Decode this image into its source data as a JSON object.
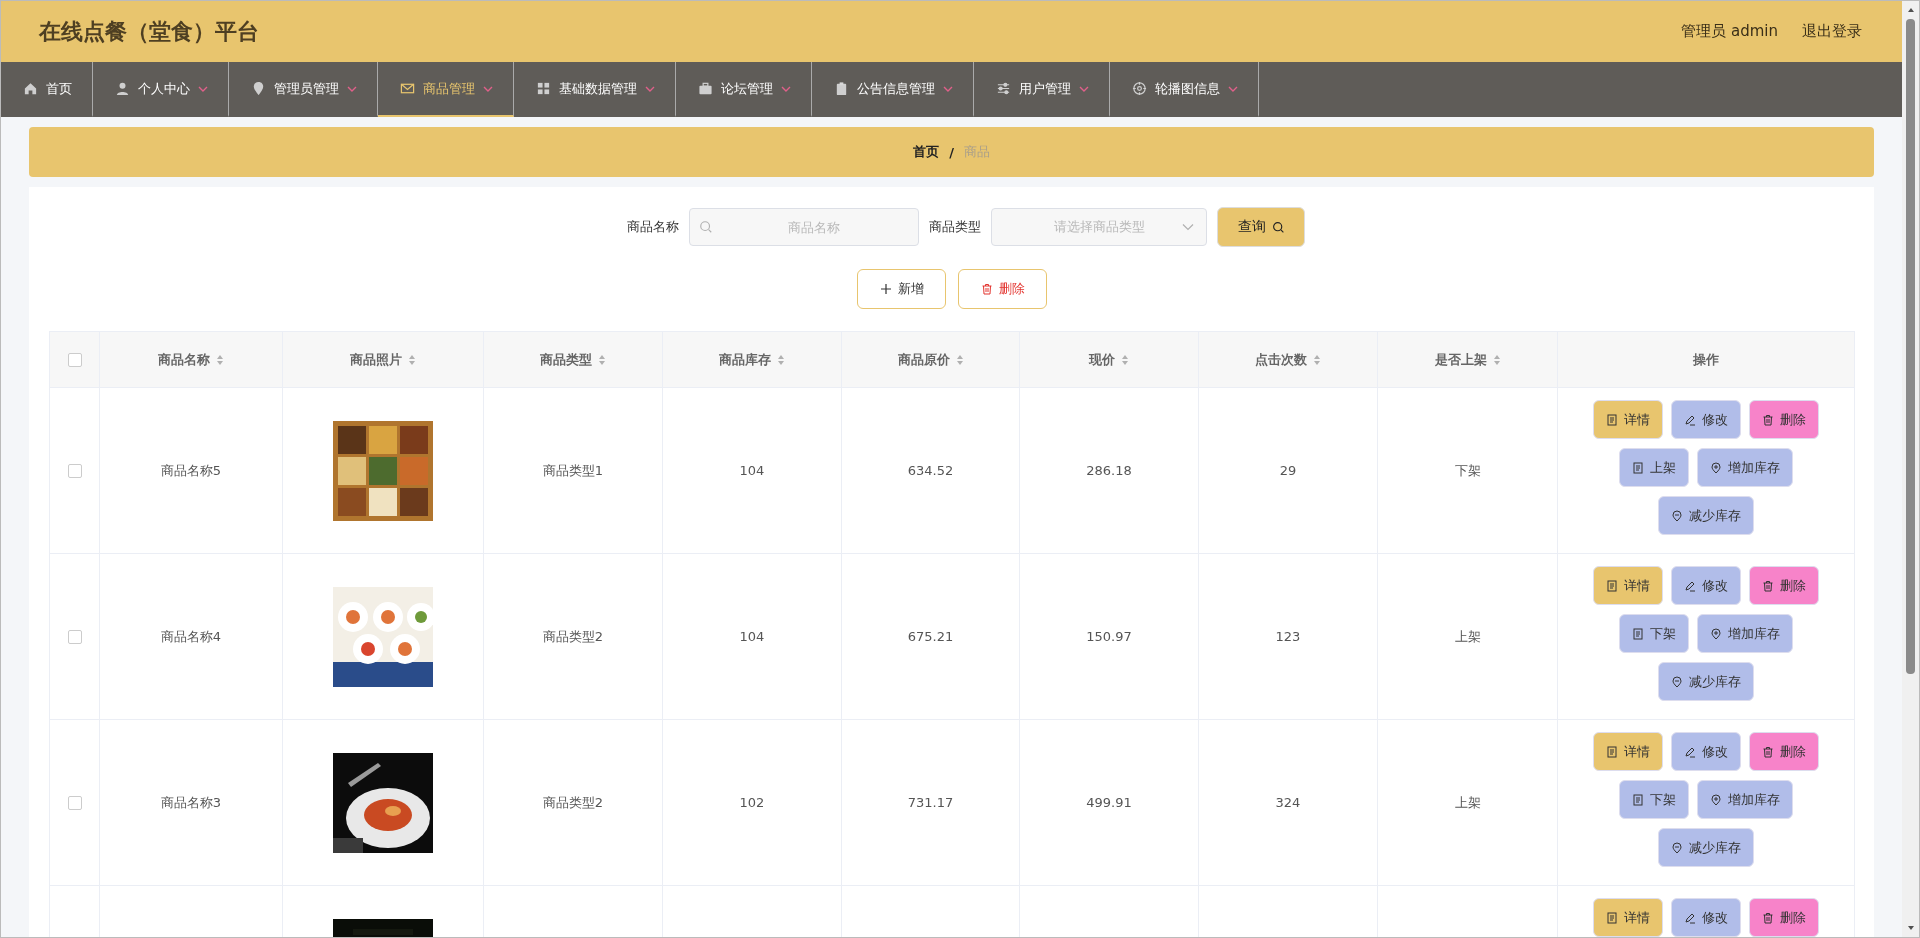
{
  "header": {
    "title": "在线点餐（堂食）平台",
    "user": "管理员 admin",
    "logout": "退出登录"
  },
  "nav": [
    {
      "label": "首页",
      "caret": false,
      "selected": false
    },
    {
      "label": "个人中心",
      "caret": true,
      "selected": false
    },
    {
      "label": "管理员管理",
      "caret": true,
      "selected": false
    },
    {
      "label": "商品管理",
      "caret": true,
      "selected": true
    },
    {
      "label": "基础数据管理",
      "caret": true,
      "selected": false
    },
    {
      "label": "论坛管理",
      "caret": true,
      "selected": false
    },
    {
      "label": "公告信息管理",
      "caret": true,
      "selected": false
    },
    {
      "label": "用户管理",
      "caret": true,
      "selected": false
    },
    {
      "label": "轮播图信息",
      "caret": true,
      "selected": false
    }
  ],
  "breadcrumb": {
    "home": "首页",
    "separator": "/",
    "current": "商品"
  },
  "search": {
    "name_label": "商品名称",
    "name_placeholder": "商品名称",
    "type_label": "商品类型",
    "type_placeholder": "请选择商品类型",
    "query_button": "查询"
  },
  "actions": {
    "add": "新增",
    "delete": "删除"
  },
  "table": {
    "select_all_checked": false,
    "columns": [
      "商品名称",
      "商品照片",
      "商品类型",
      "商品库存",
      "商品原价",
      "现价",
      "点击次数",
      "是否上架",
      "操作"
    ],
    "rows": [
      {
        "checked": false,
        "name": "商品名称5",
        "type": "商品类型1",
        "stock": "104",
        "price": "634.52",
        "now": "286.18",
        "clicks": "29",
        "status": "下架",
        "buttons": [
          [
            {
              "kind": "detail",
              "label": "详情"
            },
            {
              "kind": "edit",
              "label": "修改"
            },
            {
              "kind": "delete",
              "label": "删除"
            }
          ],
          [
            {
              "kind": "shelf",
              "label": "上架"
            },
            {
              "kind": "add",
              "label": "增加库存"
            }
          ],
          [
            {
              "kind": "reduce",
              "label": "减少库存"
            }
          ]
        ]
      },
      {
        "checked": false,
        "name": "商品名称4",
        "type": "商品类型2",
        "stock": "104",
        "price": "675.21",
        "now": "150.97",
        "clicks": "123",
        "status": "上架",
        "buttons": [
          [
            {
              "kind": "detail",
              "label": "详情"
            },
            {
              "kind": "edit",
              "label": "修改"
            },
            {
              "kind": "delete",
              "label": "删除"
            }
          ],
          [
            {
              "kind": "shelf",
              "label": "下架"
            },
            {
              "kind": "add",
              "label": "增加库存"
            }
          ],
          [
            {
              "kind": "reduce",
              "label": "减少库存"
            }
          ]
        ]
      },
      {
        "checked": false,
        "name": "商品名称3",
        "type": "商品类型2",
        "stock": "102",
        "price": "731.17",
        "now": "499.91",
        "clicks": "324",
        "status": "上架",
        "buttons": [
          [
            {
              "kind": "detail",
              "label": "详情"
            },
            {
              "kind": "edit",
              "label": "修改"
            },
            {
              "kind": "delete",
              "label": "删除"
            }
          ],
          [
            {
              "kind": "shelf",
              "label": "下架"
            },
            {
              "kind": "add",
              "label": "增加库存"
            }
          ],
          [
            {
              "kind": "reduce",
              "label": "减少库存"
            }
          ]
        ]
      },
      {
        "buttons": [
          [
            {
              "kind": "detail",
              "label": "详情"
            },
            {
              "kind": "edit",
              "label": "修改"
            },
            {
              "kind": "delete",
              "label": "删除"
            }
          ]
        ]
      }
    ]
  }
}
